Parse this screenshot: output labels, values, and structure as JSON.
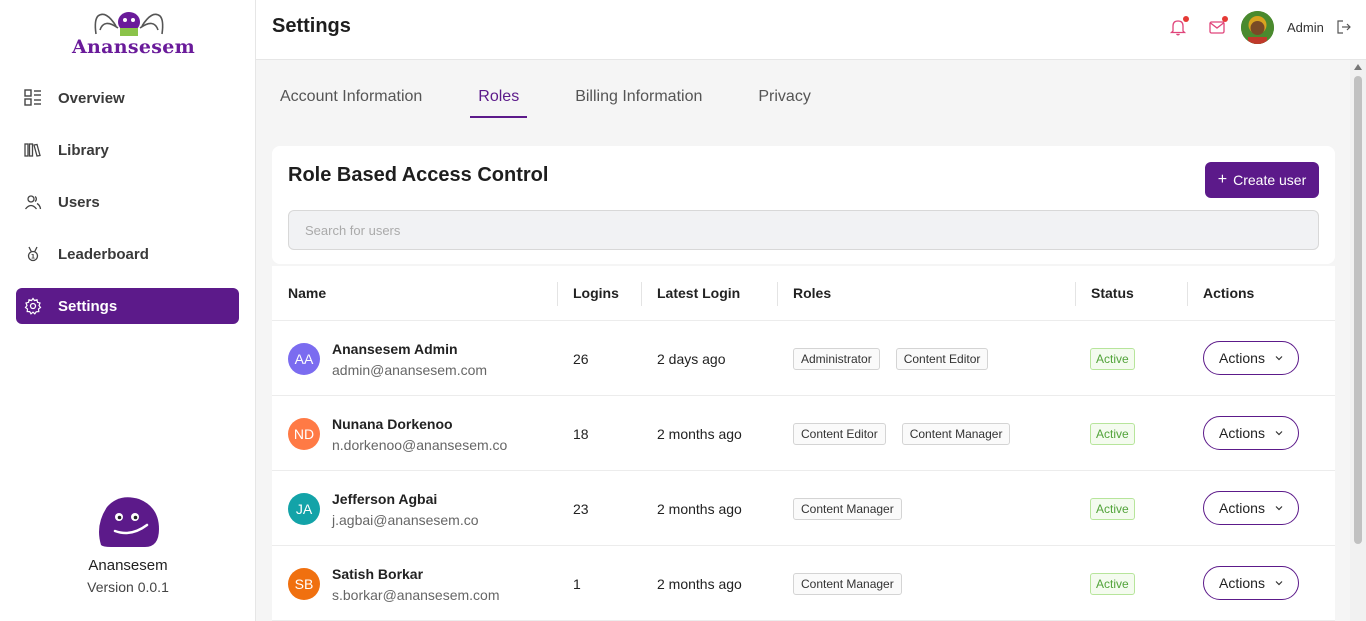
{
  "brand": {
    "logo_text": "Anansesem",
    "name": "Anansesem",
    "version": "Version 0.0.1"
  },
  "sidebar": {
    "items": [
      {
        "label": "Overview",
        "icon": "overview-grid-icon",
        "active": false
      },
      {
        "label": "Library",
        "icon": "library-books-icon",
        "active": false
      },
      {
        "label": "Users",
        "icon": "users-icon",
        "active": false
      },
      {
        "label": "Leaderboard",
        "icon": "trophy-icon",
        "active": false
      },
      {
        "label": "Settings",
        "icon": "gear-icon",
        "active": true
      }
    ]
  },
  "header": {
    "title": "Settings",
    "user_label": "Admin",
    "icons": [
      "bell-icon",
      "mail-icon",
      "avatar",
      "logout-icon"
    ]
  },
  "tabs": [
    {
      "label": "Account Information",
      "active": false
    },
    {
      "label": "Roles",
      "active": true
    },
    {
      "label": "Billing Information",
      "active": false
    },
    {
      "label": "Privacy",
      "active": false
    }
  ],
  "rbac": {
    "title": "Role Based Access Control",
    "create_label": "Create user",
    "search_placeholder": "Search for users"
  },
  "table": {
    "columns": [
      "Name",
      "Logins",
      "Latest Login",
      "Roles",
      "Status",
      "Actions"
    ],
    "rows": [
      {
        "initials": "AA",
        "avatar_color": "#7b6cf0",
        "name": "Anansesem Admin",
        "email": "admin@anansesem.com",
        "logins": "26",
        "latest": "2 days ago",
        "roles": [
          "Administrator",
          "Content Editor"
        ],
        "status": "Active",
        "action": "Actions"
      },
      {
        "initials": "ND",
        "avatar_color": "#ff7a45",
        "name": "Nunana Dorkenoo",
        "email": "n.dorkenoo@anansesem.co",
        "logins": "18",
        "latest": "2 months ago",
        "roles": [
          "Content Editor",
          "Content Manager"
        ],
        "status": "Active",
        "action": "Actions"
      },
      {
        "initials": "JA",
        "avatar_color": "#13a3a8",
        "name": "Jefferson Agbai",
        "email": "j.agbai@anansesem.co",
        "logins": "23",
        "latest": "2 months ago",
        "roles": [
          "Content Manager"
        ],
        "status": "Active",
        "action": "Actions"
      },
      {
        "initials": "SB",
        "avatar_color": "#f0700f",
        "name": "Satish Borkar",
        "email": "s.borkar@anansesem.com",
        "logins": "1",
        "latest": "2 months ago",
        "roles": [
          "Content Manager"
        ],
        "status": "Active",
        "action": "Actions"
      }
    ]
  },
  "colors": {
    "accent": "#5c1a8a",
    "status_active": "#52a33a"
  }
}
